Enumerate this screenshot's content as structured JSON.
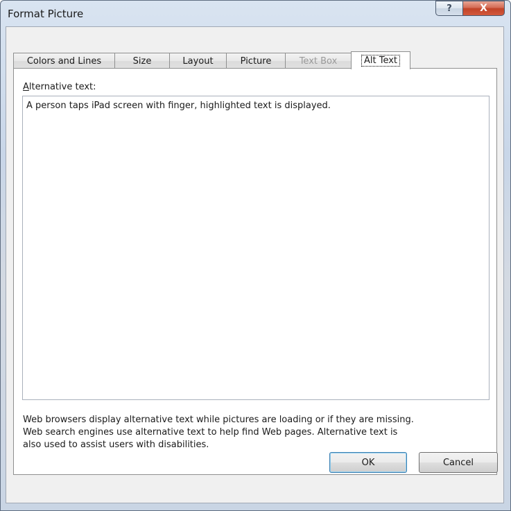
{
  "window": {
    "title": "Format Picture",
    "help_symbol": "?",
    "close_symbol": "X"
  },
  "tabs": [
    {
      "label": "Colors and Lines",
      "state": "normal"
    },
    {
      "label": "Size",
      "state": "normal"
    },
    {
      "label": "Layout",
      "state": "normal"
    },
    {
      "label": "Picture",
      "state": "normal"
    },
    {
      "label": "Text Box",
      "state": "disabled"
    },
    {
      "label": "Alt Text",
      "state": "active"
    }
  ],
  "alt_text": {
    "label_accel": "A",
    "label_rest": "lternative text:",
    "value": "A person taps iPad screen with finger, highlighted text is displayed."
  },
  "description": {
    "line1": "Web browsers display alternative text while pictures are loading or if they are missing.",
    "line2": "Web search engines use alternative text to help find Web pages.  Alternative text is",
    "line3": "also used to assist users with disabilities."
  },
  "buttons": {
    "ok": "OK",
    "cancel": "Cancel"
  },
  "colors": {
    "close_button": "#c14328",
    "default_button_border": "#3c7fb1",
    "disabled_text": "#9a9a9a"
  }
}
